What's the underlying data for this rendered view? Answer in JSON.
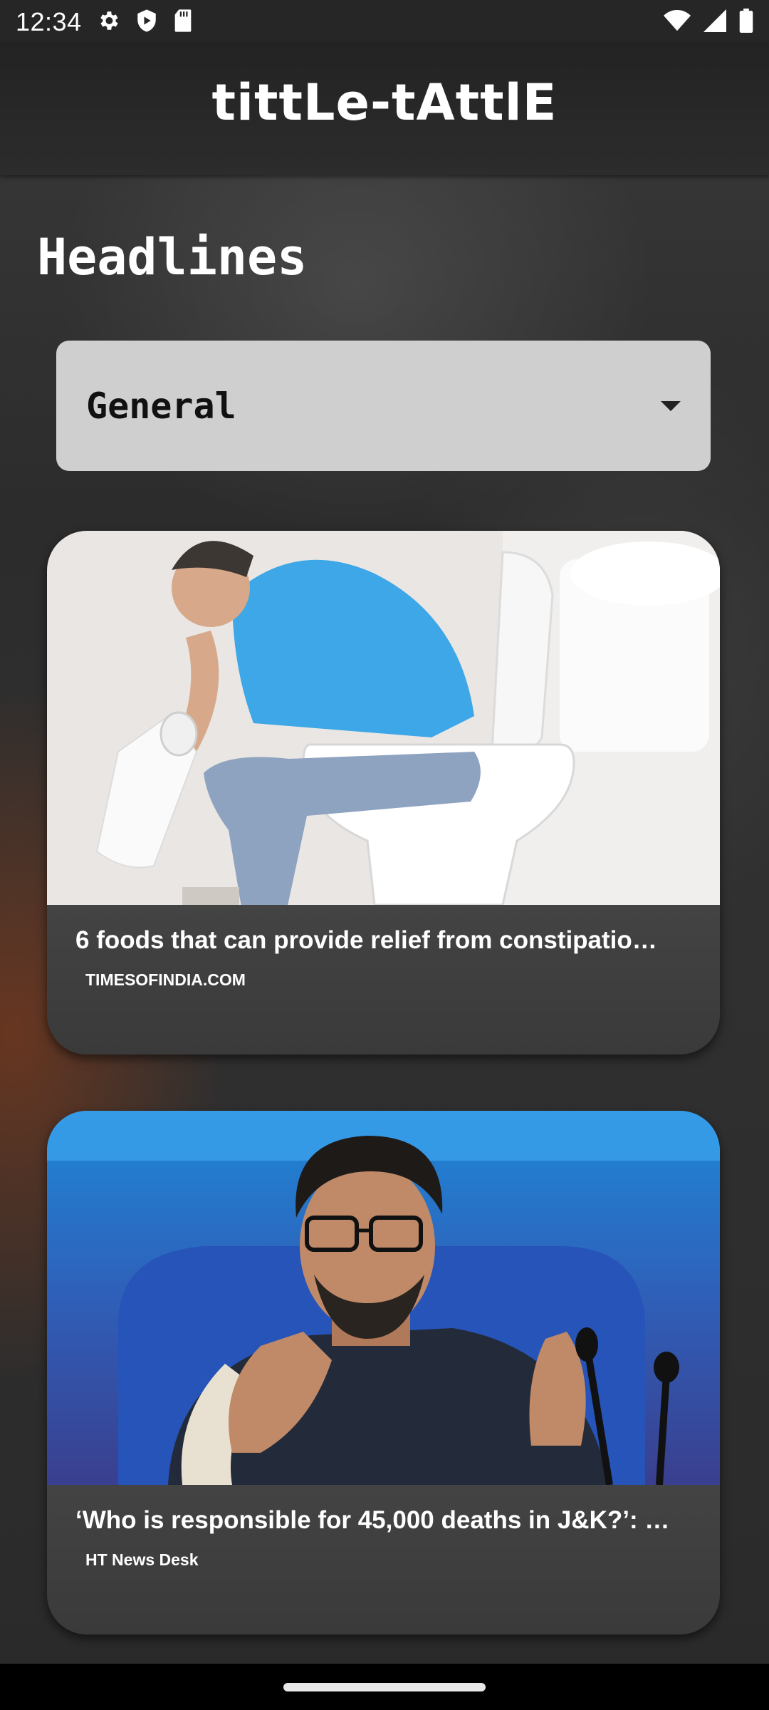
{
  "status_bar": {
    "time": "12:34",
    "left_icons": [
      "settings-icon",
      "play-protect-icon",
      "sd-card-icon"
    ],
    "right_icons": [
      "wifi-icon",
      "signal-icon",
      "battery-icon"
    ]
  },
  "app_bar": {
    "logo_text": "tittLe-tAttlE"
  },
  "page": {
    "title": "Headlines"
  },
  "category_dropdown": {
    "selected": "General"
  },
  "articles": [
    {
      "title": "6 foods that can provide relief from constipatio…",
      "source": "TIMESOFINDIA.COM",
      "image_icon": "article-photo-toilet"
    },
    {
      "title": "‘Who is responsible for 45,000 deaths in J&K?’: …",
      "source": "HT News Desk",
      "image_icon": "article-photo-press-conference"
    }
  ],
  "colors": {
    "background": "#2e2e2e",
    "dropdown_bg": "#cfcfcf",
    "card_bg": "#424242"
  }
}
